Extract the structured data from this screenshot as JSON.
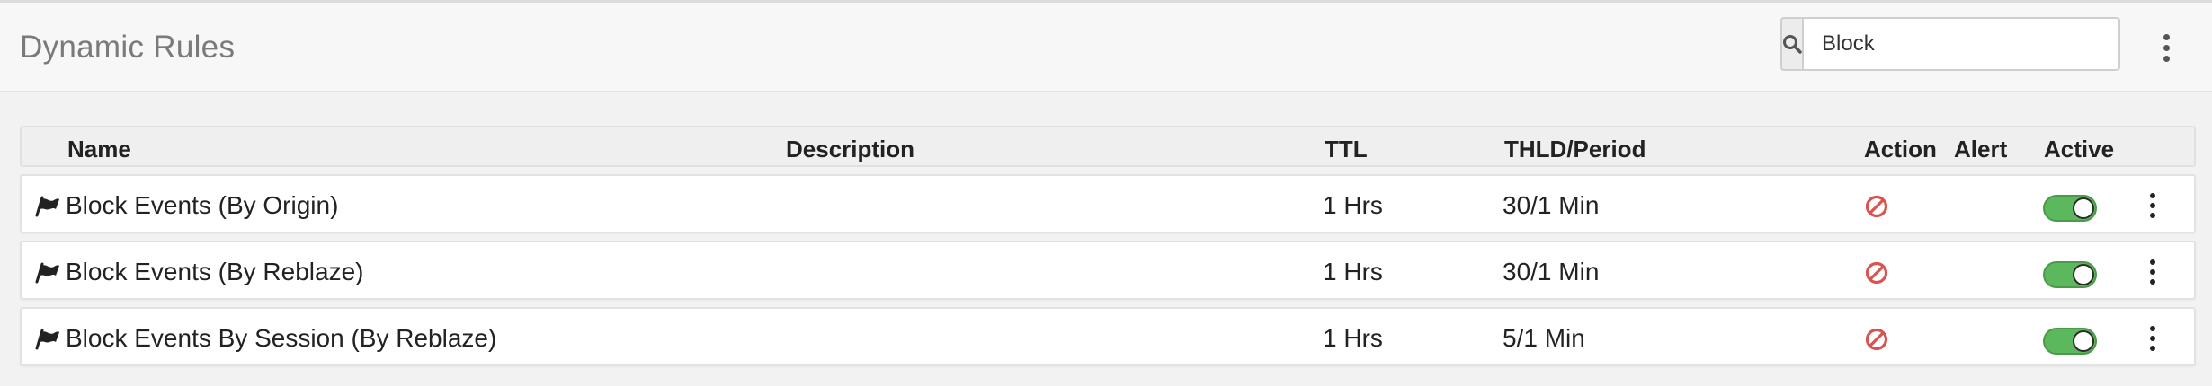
{
  "header": {
    "title": "Dynamic Rules",
    "search": {
      "value": "Block",
      "placeholder": ""
    }
  },
  "table": {
    "columns": {
      "name": "Name",
      "description": "Description",
      "ttl": "TTL",
      "thld_period": "THLD/Period",
      "action": "Action",
      "alert": "Alert",
      "active": "Active"
    },
    "rows": [
      {
        "name": "Block Events (By Origin)",
        "description": "",
        "ttl": "1 Hrs",
        "thld_period": "30/1 Min",
        "action": "block",
        "alert": false,
        "active": true
      },
      {
        "name": "Block Events (By Reblaze)",
        "description": "",
        "ttl": "1 Hrs",
        "thld_period": "30/1 Min",
        "action": "block",
        "alert": false,
        "active": true
      },
      {
        "name": "Block Events By Session (By Reblaze)",
        "description": "",
        "ttl": "1 Hrs",
        "thld_period": "5/1 Min",
        "action": "block",
        "alert": false,
        "active": true
      }
    ]
  },
  "icons": {
    "search": "search-icon",
    "menu": "more-vertical-icon",
    "rule_type": "flag-icon",
    "action": "block-icon"
  },
  "colors": {
    "toggle_on": "#5cb85c",
    "block_action": "#d9534f",
    "title": "#7a7a7a"
  }
}
